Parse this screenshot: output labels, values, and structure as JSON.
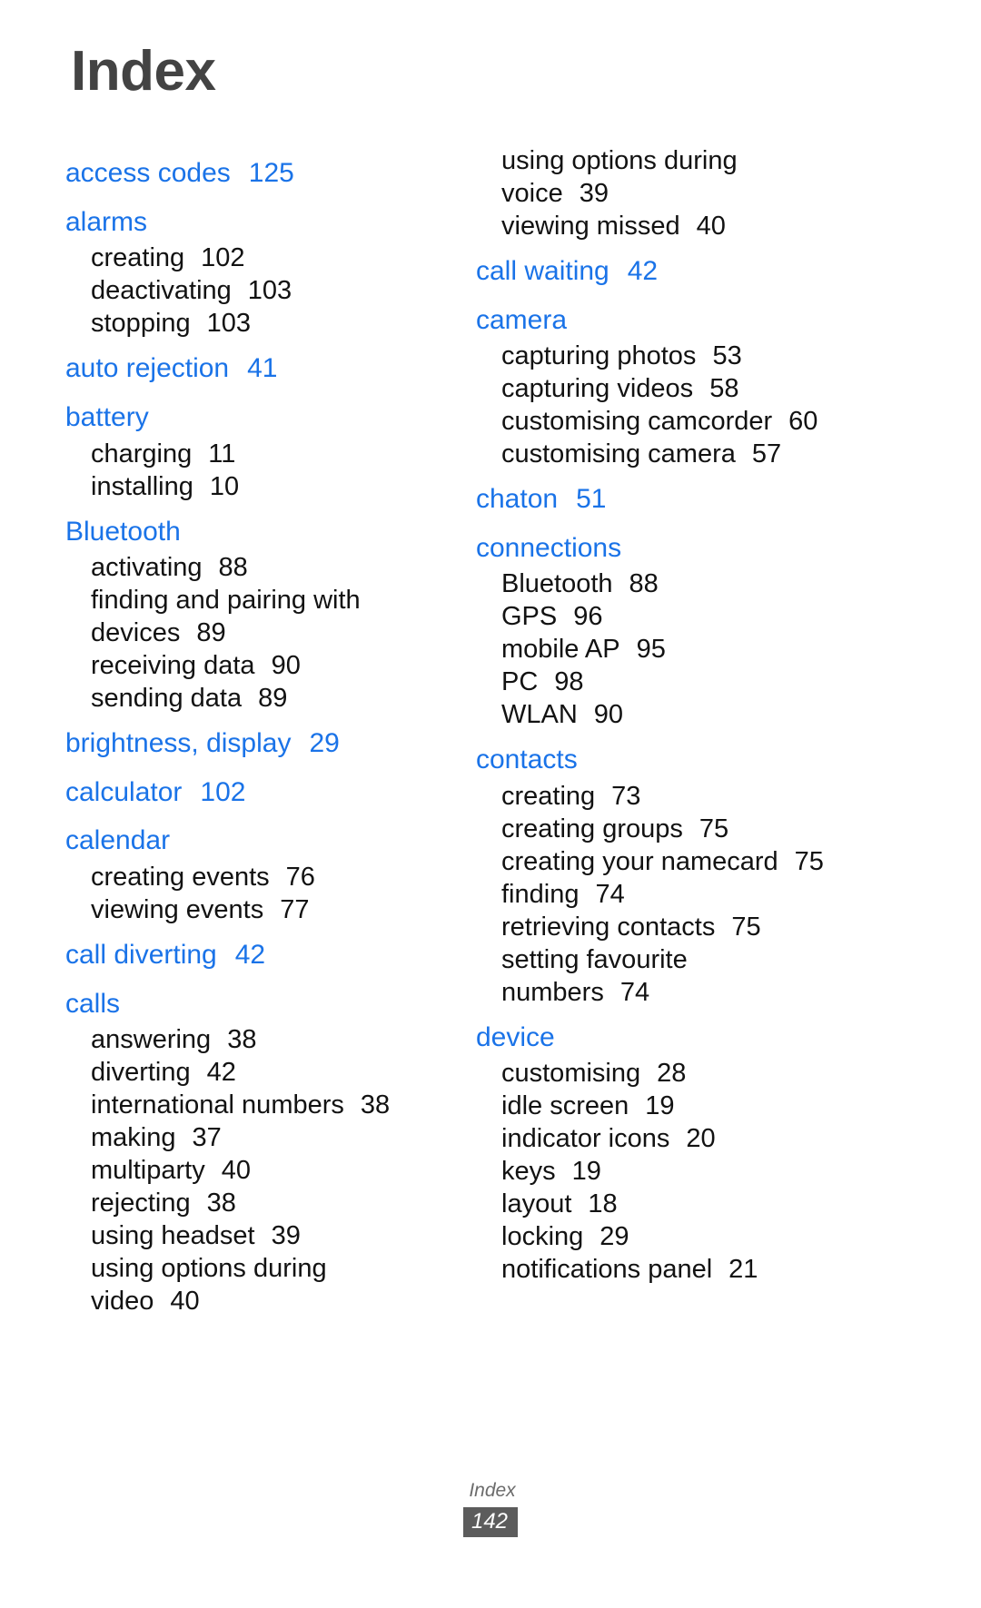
{
  "page": {
    "title": "Index",
    "footer_label": "Index",
    "footer_page_number": "142",
    "heading_color": "#1a73e8",
    "title_color": "#434343",
    "body_color": "#121212",
    "footer_badge_color": "#5c5c5c"
  },
  "columns": [
    {
      "id": "left",
      "groups": [
        {
          "heading": "access codes",
          "heading_page": "125",
          "subentries": []
        },
        {
          "heading": "alarms",
          "heading_page": "",
          "subentries": [
            {
              "label": "creating",
              "page": "102"
            },
            {
              "label": "deactivating",
              "page": "103"
            },
            {
              "label": "stopping",
              "page": "103"
            }
          ]
        },
        {
          "heading": "auto rejection",
          "heading_page": "41",
          "subentries": []
        },
        {
          "heading": "battery",
          "heading_page": "",
          "subentries": [
            {
              "label": "charging",
              "page": "11"
            },
            {
              "label": "installing",
              "page": "10"
            }
          ]
        },
        {
          "heading": "Bluetooth",
          "heading_page": "",
          "subentries": [
            {
              "label": "activating",
              "page": "88"
            },
            {
              "label": "finding and pairing with",
              "page": ""
            },
            {
              "label": "devices",
              "page": "89"
            },
            {
              "label": "receiving data",
              "page": "90"
            },
            {
              "label": "sending data",
              "page": "89"
            }
          ]
        },
        {
          "heading": "brightness, display",
          "heading_page": "29",
          "subentries": []
        },
        {
          "heading": "calculator",
          "heading_page": "102",
          "subentries": []
        },
        {
          "heading": "calendar",
          "heading_page": "",
          "subentries": [
            {
              "label": "creating events",
              "page": "76"
            },
            {
              "label": "viewing events",
              "page": "77"
            }
          ]
        },
        {
          "heading": "call diverting",
          "heading_page": "42",
          "subentries": []
        },
        {
          "heading": "calls",
          "heading_page": "",
          "subentries": [
            {
              "label": "answering",
              "page": "38"
            },
            {
              "label": "diverting",
              "page": "42"
            },
            {
              "label": "international numbers",
              "page": "38"
            },
            {
              "label": "making",
              "page": "37"
            },
            {
              "label": "multiparty",
              "page": "40"
            },
            {
              "label": "rejecting",
              "page": "38"
            },
            {
              "label": "using headset",
              "page": "39"
            },
            {
              "label": "using options during",
              "page": ""
            },
            {
              "label": "video",
              "page": "40"
            }
          ]
        }
      ]
    },
    {
      "id": "right",
      "groups": [
        {
          "heading": "",
          "heading_page": "",
          "subentries": [
            {
              "label": "using options during",
              "page": ""
            },
            {
              "label": "voice",
              "page": "39"
            },
            {
              "label": "viewing missed",
              "page": "40"
            }
          ]
        },
        {
          "heading": "call waiting",
          "heading_page": "42",
          "subentries": []
        },
        {
          "heading": "camera",
          "heading_page": "",
          "subentries": [
            {
              "label": "capturing photos",
              "page": "53"
            },
            {
              "label": "capturing videos",
              "page": "58"
            },
            {
              "label": "customising camcorder",
              "page": "60"
            },
            {
              "label": "customising camera",
              "page": "57"
            }
          ]
        },
        {
          "heading": "chaton",
          "heading_page": "51",
          "subentries": []
        },
        {
          "heading": "connections",
          "heading_page": "",
          "subentries": [
            {
              "label": "Bluetooth",
              "page": "88"
            },
            {
              "label": "GPS",
              "page": "96"
            },
            {
              "label": "mobile AP",
              "page": "95"
            },
            {
              "label": "PC",
              "page": "98"
            },
            {
              "label": "WLAN",
              "page": "90"
            }
          ]
        },
        {
          "heading": "contacts",
          "heading_page": "",
          "subentries": [
            {
              "label": "creating",
              "page": "73"
            },
            {
              "label": "creating groups",
              "page": "75"
            },
            {
              "label": "creating your namecard",
              "page": "75"
            },
            {
              "label": "finding",
              "page": "74"
            },
            {
              "label": "retrieving contacts",
              "page": "75"
            },
            {
              "label": "setting favourite",
              "page": ""
            },
            {
              "label": "numbers",
              "page": "74"
            }
          ]
        },
        {
          "heading": "device",
          "heading_page": "",
          "subentries": [
            {
              "label": "customising",
              "page": "28"
            },
            {
              "label": "idle screen",
              "page": "19"
            },
            {
              "label": "indicator icons",
              "page": "20"
            },
            {
              "label": "keys",
              "page": "19"
            },
            {
              "label": "layout",
              "page": "18"
            },
            {
              "label": "locking",
              "page": "29"
            },
            {
              "label": "notifications panel",
              "page": "21"
            }
          ]
        }
      ]
    }
  ]
}
